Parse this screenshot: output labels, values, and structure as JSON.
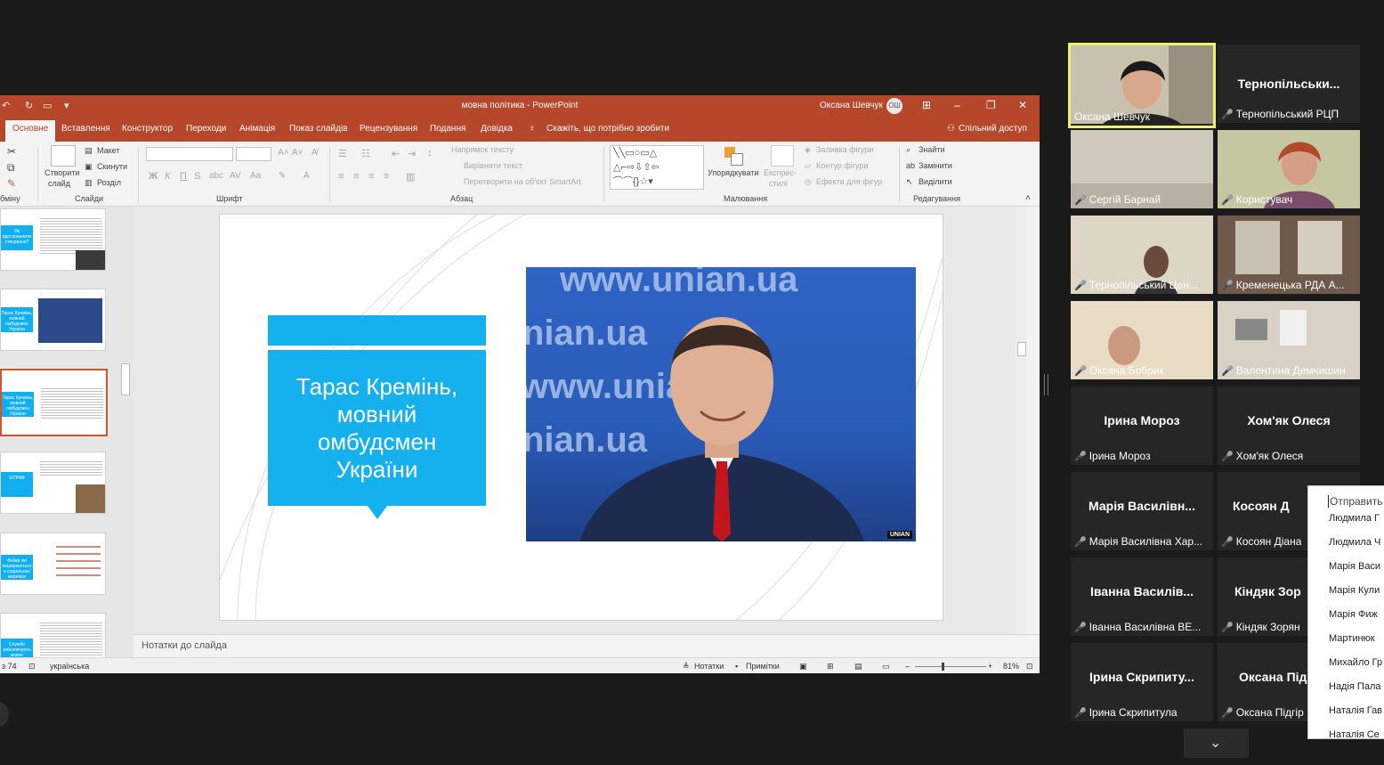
{
  "powerpoint": {
    "title": "мовна політика - PowerPoint",
    "user": "Оксана Шевчук",
    "avatar": "ОШ",
    "tabs": [
      "Основне",
      "Вставлення",
      "Конструктор",
      "Переходи",
      "Анімація",
      "Показ слайдів",
      "Рецензування",
      "Подання",
      "Довідка"
    ],
    "tell_me": "Скажіть, що потрібно зробити",
    "share": "Спільний доступ",
    "ribbon": {
      "new_slide_line1": "Створити",
      "new_slide_line2": "слайд",
      "layout": "Макет",
      "reset": "Скинути",
      "section": "Розділ",
      "text_direction": "Напрямок тексту",
      "align_text": "Вирівняти текст",
      "smartart": "Перетворити на об'єкт SmartArt",
      "arrange": "Упорядкувати",
      "quick_styles_line1": "Експрес-",
      "quick_styles_line2": "стилі",
      "shape_fill": "Заливка фігури",
      "shape_outline": "Контур фігури",
      "shape_effects": "Ефекти для фігур",
      "find": "Знайти",
      "replace": "Замінити",
      "select": "Виділити",
      "groups": {
        "clipboard": "бміну",
        "slides": "Слайди",
        "font": "Шрифт",
        "paragraph": "Абзац",
        "drawing": "Малювання",
        "editing": "Редагування"
      }
    },
    "slide": {
      "title": "Тарас Кремінь, мовний омбудсмен України",
      "watermark": [
        "www.unian.ua",
        "nian.ua",
        "www.unian.ua",
        "nian.ua"
      ],
      "logo": "UNIAN"
    },
    "thumbnails": [
      {
        "label": "Як вдосконалити створення?"
      },
      {
        "label": "Тарас Кремінь, мовний омбудсмен України"
      },
      {
        "label": "Тарас Кремінь, мовний омбудсмен України"
      },
      {
        "label": "ШТРАФ"
      },
      {
        "label": "Фейки які поширюються в соціальних мережах"
      },
      {
        "label": "Служби забезпечують мовне законодавство"
      }
    ],
    "notes_placeholder": "Нотатки до слайда",
    "status": {
      "slide_count": "з 74",
      "language": "українська",
      "notes": "Нотатки",
      "comments": "Примітки",
      "zoom": "81%"
    }
  },
  "participants": [
    {
      "display": "",
      "name": "Оксана Шевчук",
      "muted": false,
      "active": true
    },
    {
      "display": "Тернопільськи...",
      "name": "Тернопільський РЦП",
      "muted": true
    },
    {
      "display": "",
      "name": "Сергій Барнай",
      "muted": true
    },
    {
      "display": "",
      "name": "Користувач",
      "muted": true
    },
    {
      "display": "",
      "name": "Тернопільський Цен...",
      "muted": true
    },
    {
      "display": "",
      "name": "Кременецька РДА А...",
      "muted": true
    },
    {
      "display": "",
      "name": "Оксана Бобрик",
      "muted": true
    },
    {
      "display": "",
      "name": "Валентина Демчишин",
      "muted": true
    },
    {
      "display": "Ірина Мороз",
      "name": "Ірина Мороз",
      "muted": true
    },
    {
      "display": "Хом'як Олеся",
      "name": "Хом'як Олеся",
      "muted": true
    },
    {
      "display": "Марія Василівн...",
      "name": "Марія Василівна Хар...",
      "muted": true
    },
    {
      "display": "Косоян Д",
      "name": "Косоян Діана",
      "muted": true
    },
    {
      "display": "Іванна Василів...",
      "name": "Іванна Василівна ВЕ...",
      "muted": true
    },
    {
      "display": "Кіндяк Зор",
      "name": "Кіндяк Зорян",
      "muted": true
    },
    {
      "display": "Ірина Скрипиту...",
      "name": "Ірина Скрипитула",
      "muted": true
    },
    {
      "display": "Оксана Під",
      "name": "Оксана Підгір",
      "muted": true
    }
  ],
  "chat_popup": {
    "input_placeholder": "Отправить",
    "items": [
      "Людмила Г",
      "Людмила Ч",
      "Марія Васи",
      "Марія Кули",
      "Марія Фиж",
      "Мартинюк",
      "Михайло Гр",
      "Надія Пала",
      "Наталія Гав",
      "Наталія Се"
    ]
  },
  "colors": {
    "ppt_accent": "#b7472a",
    "slide_blue": "#15b1ef",
    "active_speaker": "#e8f36f",
    "mic_muted": "#e43c3c"
  }
}
